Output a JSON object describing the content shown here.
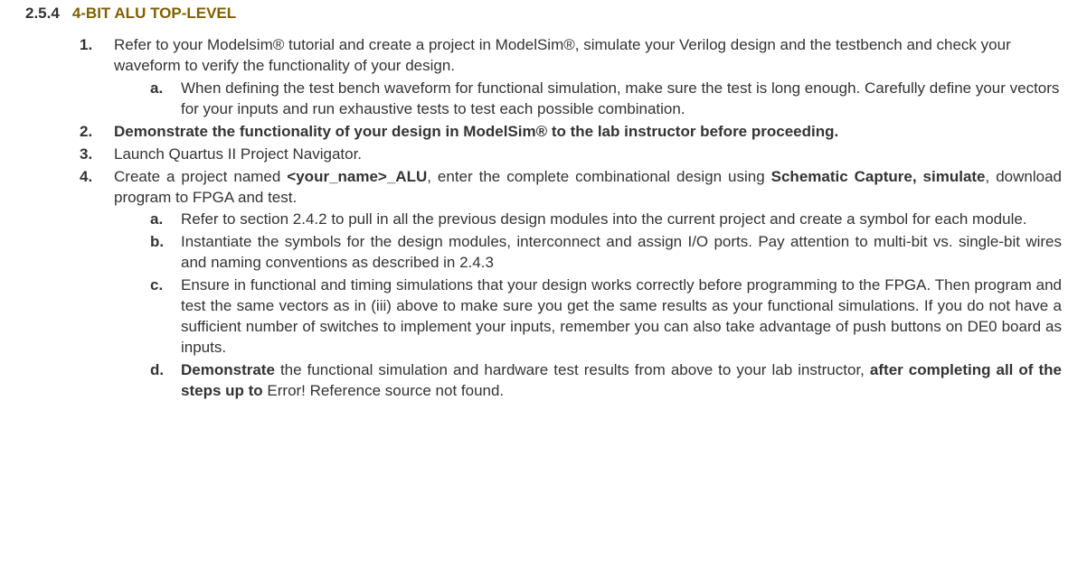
{
  "section": {
    "number": "2.5.4",
    "title": "4-BIT ALU TOP-LEVEL"
  },
  "items": {
    "1": {
      "num": "1.",
      "text": "Refer to your Modelsim® tutorial and create a project in ModelSim®, simulate your Verilog design and the testbench and check your waveform to verify the functionality of your design.",
      "a": {
        "num": "a.",
        "text": "When defining the test bench waveform for functional simulation, make sure the test is long enough. Carefully define your vectors for your inputs and run exhaustive tests to test each possible combination."
      }
    },
    "2": {
      "num": "2.",
      "text": "Demonstrate the functionality of your design in ModelSim® to the lab instructor before proceeding."
    },
    "3": {
      "num": "3.",
      "text": "Launch Quartus II Project Navigator."
    },
    "4": {
      "num": "4.",
      "pre": "Create a project named ",
      "code": "<your_name>_ALU",
      "mid": ", enter the complete combinational design using ",
      "bold2": "Schematic Capture, simulate",
      "post": ", download program to FPGA and test.",
      "a": {
        "num": "a.",
        "text": "Refer to section 2.4.2 to pull in all the previous design modules into the current project and create a symbol for each module."
      },
      "b": {
        "num": "b.",
        "text": "Instantiate the symbols for the design modules, interconnect and assign I/O ports. Pay attention to multi-bit vs. single-bit wires and naming conventions as described in 2.4.3"
      },
      "c": {
        "num": "c.",
        "text": "Ensure in functional and timing simulations that your design works correctly before programming to the FPGA. Then program and test the same vectors as in (iii) above to make sure you get the same results as your functional simulations. If you do not have a sufficient number of switches to implement your inputs, remember you can also take advantage of push buttons on DE0 board as inputs."
      },
      "d": {
        "num": "d.",
        "b1": "Demonstrate",
        "t1": " the functional simulation and hardware test results from above to your lab instructor, ",
        "b2": "after completing all of the steps up to ",
        "t2": "Error! Reference source not found."
      }
    }
  }
}
